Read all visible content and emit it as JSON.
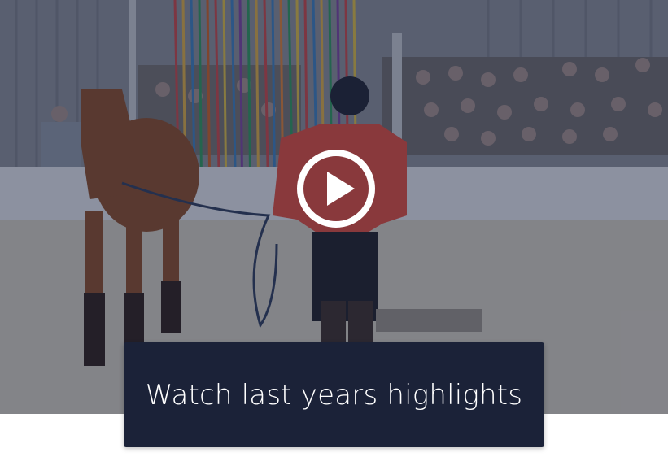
{
  "video": {
    "play_icon": "play-circle-icon",
    "caption": "Watch last years highlights"
  },
  "colors": {
    "caption_background": "#1b2238",
    "caption_text": "#ffffff",
    "overlay": "#1d2540",
    "play_icon": "#ffffff"
  }
}
